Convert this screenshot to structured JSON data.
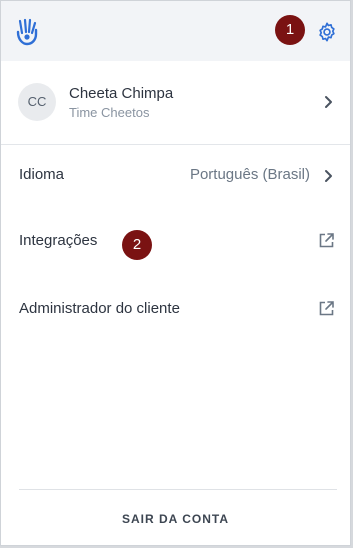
{
  "icons": {
    "logo": "hand-logo-icon",
    "settings": "gear-icon",
    "chevron": "chevron-right-icon",
    "external": "external-link-icon"
  },
  "colors": {
    "accent": "#2f6fd6",
    "badge": "#7a1212",
    "topbar": "#f2f4f7"
  },
  "badges": {
    "first": "1",
    "second": "2"
  },
  "user": {
    "initials": "CC",
    "name": "Cheeta Chimpa",
    "org": "Time Cheetos"
  },
  "menu": {
    "language_label": "Idioma",
    "language_value": "Português (Brasil)",
    "integrations_label": "Integrações",
    "admin_label": "Administrador do cliente",
    "logout_label": "SAIR DA CONTA"
  }
}
